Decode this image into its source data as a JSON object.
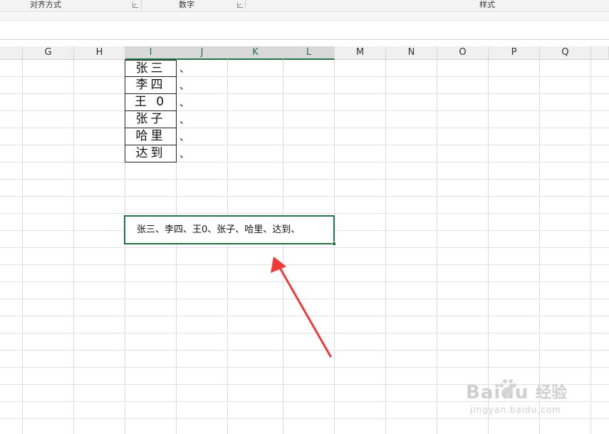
{
  "ribbon": {
    "groups": [
      {
        "label": "对齐方式"
      },
      {
        "label": "数字"
      },
      {
        "label": "样式"
      }
    ]
  },
  "columns": [
    "G",
    "H",
    "I",
    "J",
    "K",
    "L",
    "M",
    "N",
    "O",
    "P",
    "Q"
  ],
  "selected_columns": [
    "I",
    "J",
    "K",
    "L"
  ],
  "names": [
    "张三",
    "李四",
    "王 0",
    "张子",
    "哈里",
    "达到"
  ],
  "separator": "、",
  "result_text": "张三、李四、王0、张子、哈里、达到、",
  "watermark": {
    "logo": "Baidu",
    "subtitle": "经验",
    "url": "jingyan.baidu.com"
  },
  "colors": {
    "selection": "#217346",
    "arrow": "#f03a3a"
  }
}
